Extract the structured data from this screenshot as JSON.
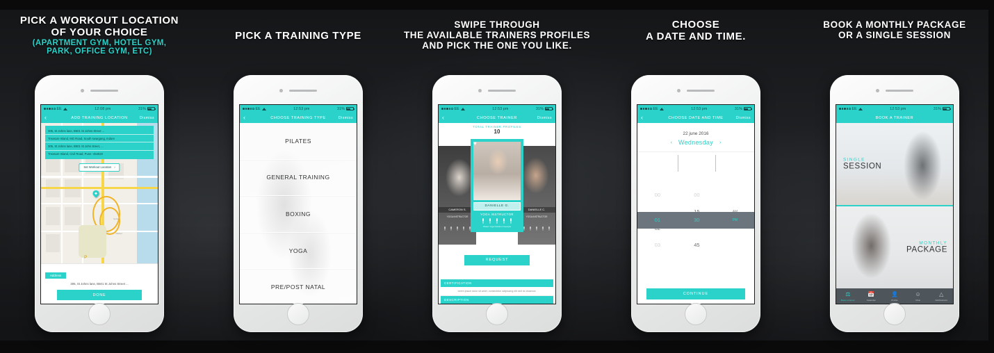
{
  "theme": {
    "accent": "#2ad2c9",
    "background": "#1b1c1e",
    "caption_color": "#ffffff",
    "selection_band": "#6c757d"
  },
  "panels": [
    {
      "caption": {
        "lines": [
          "PICK A WORKOUT LOCATION",
          "OF YOUR CHOICE"
        ],
        "sub": [
          "(APARTMENT GYM, HOTEL GYM,",
          "PARK, OFFICE GYM, ETC)"
        ]
      },
      "status": {
        "carrier": "EE",
        "time": "12:08 pm",
        "battery": "31%"
      },
      "nav": {
        "title": "ADD TRAINING LOCATION",
        "back": "‹",
        "right": "Dismiss"
      },
      "suggestions": [
        "305, St Johns lane, B501 St Johns Street ...",
        "Treasure Island, MG Road, South swargang, Indore",
        "305, St Johns lane, B501 St John street, ...",
        "Treasure Island, Civil Road, Pune -454520"
      ],
      "set_location_label": "Set Workout Location",
      "address_tag": "Address",
      "address_text": "305, St Johns lane, B501 St Johns Street ...",
      "done_button": "DONE",
      "map_labels": [
        "Spring",
        "Market",
        "P",
        "I-90",
        "Battery"
      ]
    },
    {
      "caption": {
        "lines": [
          "PICK A TRAINING TYPE"
        ],
        "sub": []
      },
      "status": {
        "carrier": "EE",
        "time": "12:53 pm",
        "battery": "31%"
      },
      "nav": {
        "title": "CHOOSE TRAINING TYPE",
        "back": "‹",
        "right": "Dismiss"
      },
      "training_types": [
        "PILATES",
        "GENERAL TRAINING",
        "BOXING",
        "YOGA",
        "PRE/POST NATAL"
      ]
    },
    {
      "caption": {
        "lines": [
          "SWIPE THROUGH",
          "THE AVAILABLE TRAINERS PROFILES",
          "AND PICK THE ONE YOU LIKE."
        ],
        "sub": []
      },
      "status": {
        "carrier": "EE",
        "time": "12:53 pm",
        "battery": "31%"
      },
      "nav": {
        "title": "CHOOSE TRAINER",
        "back": "‹",
        "right": "Dismiss"
      },
      "count_label": "TOTAL TRAINER PROFILES",
      "count_value": "10",
      "trainer_main": {
        "name": "DANIELLE G.",
        "role": "YOGA INSTRUCTOR",
        "rating": 5,
        "note": "Pilates Yoga Nutrition Freestyle",
        "favorite_icon": "♥"
      },
      "trainer_left": {
        "name": "CAMERON S.",
        "role": "YOGA INSTRUCTOR"
      },
      "trainer_right": {
        "name": "DANIELLE C.",
        "role": "YOGA INSTRUCTOR"
      },
      "request_button": "REQUEST",
      "accordion_1_title": "CERTIFICATION",
      "accordion_body": "lorem ipsum dolor sit amet, consectetur adipiscing elit sed do eiusmod.",
      "accordion_2_title": "DESCRIPTION"
    },
    {
      "caption": {
        "lines": [
          "CHOOSE",
          "A DATE AND TIME."
        ],
        "sub": []
      },
      "status": {
        "carrier": "EE",
        "time": "12:53 pm",
        "battery": "31%"
      },
      "nav": {
        "title": "CHOOSE DATE AND TIME",
        "back": "‹",
        "right": "Dismiss"
      },
      "date": "22 june 2016",
      "day": "Wednesday",
      "prev_arrow": "‹",
      "next_arrow": "›",
      "hours": [
        "00",
        "01",
        "02",
        "03"
      ],
      "minutes": [
        "00",
        "15",
        "30",
        "45"
      ],
      "meridiem": [
        "AM",
        "PM"
      ],
      "selected_hour": "01",
      "selected_minute": "30",
      "selected_meridiem": "PM",
      "continue_button": "CONTINUE"
    },
    {
      "caption": {
        "lines": [
          "BOOK A MONTHLY PACKAGE",
          "OR A SINGLE SESSION"
        ],
        "sub": []
      },
      "status": {
        "carrier": "EE",
        "time": "12:53 pm",
        "battery": "31%"
      },
      "nav": {
        "title": "BOOK A TRAINER",
        "back": "",
        "right": ""
      },
      "card_single": {
        "top": "SINGLE",
        "bottom": "SESSION"
      },
      "card_monthly": {
        "top": "MONTHLY",
        "bottom": "PACKAGE"
      },
      "tabs": [
        {
          "label": "Book a trainer",
          "icon": "⬤",
          "active": true
        },
        {
          "label": "Calendar",
          "icon": "▦",
          "active": false
        },
        {
          "label": "Profile",
          "icon": "●",
          "active": false
        },
        {
          "label": "Chat",
          "icon": "◯",
          "active": false
        },
        {
          "label": "Notifications",
          "icon": "△",
          "active": false
        }
      ]
    }
  ]
}
